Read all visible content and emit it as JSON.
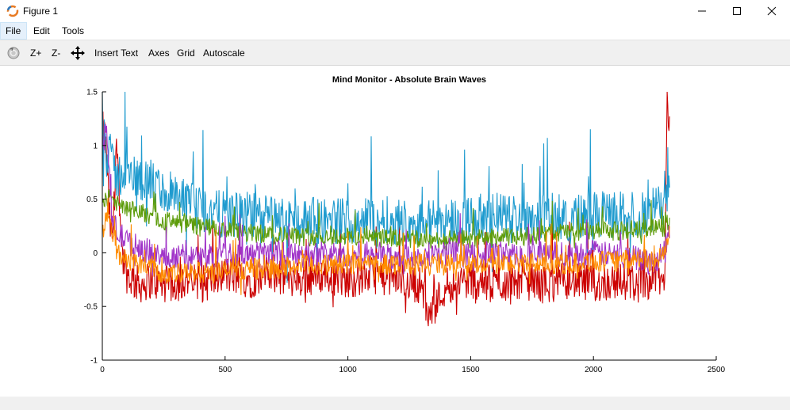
{
  "window": {
    "title": "Figure 1"
  },
  "menu": {
    "file": "File",
    "edit": "Edit",
    "tools": "Tools"
  },
  "toolbar": {
    "zoom_in": "Z+",
    "zoom_out": "Z-",
    "insert_text": "Insert Text",
    "axes": "Axes",
    "grid": "Grid",
    "autoscale": "Autoscale"
  },
  "chart_data": {
    "type": "line",
    "title": "Mind Monitor - Absolute Brain Waves",
    "xlim": [
      0,
      2500
    ],
    "ylim": [
      -1,
      1.5
    ],
    "xticks": [
      0,
      500,
      1000,
      1500,
      2000,
      2500
    ],
    "yticks": [
      -1,
      -0.5,
      0,
      0.5,
      1,
      1.5
    ],
    "xtick_labels": [
      "0",
      "500",
      "1000",
      "1500",
      "2000",
      "2500"
    ],
    "ytick_labels": [
      "-1",
      "-0.5",
      "0",
      "0.5",
      "1",
      "1.5"
    ],
    "grid": false,
    "series": [
      {
        "color": "#cc0000",
        "x": [
          0,
          10,
          20,
          30,
          40,
          50,
          60,
          80,
          100,
          120,
          150,
          200,
          250,
          300,
          350,
          400,
          450,
          500,
          600,
          700,
          800,
          900,
          1000,
          1100,
          1200,
          1300,
          1330,
          1400,
          1500,
          1600,
          1700,
          1800,
          1900,
          2000,
          2100,
          2200,
          2250,
          2290,
          2300,
          2310
        ],
        "values": [
          1.15,
          1.1,
          0.8,
          0.3,
          0.1,
          0.6,
          1.05,
          0.0,
          -0.2,
          -0.25,
          -0.3,
          -0.25,
          -0.3,
          -0.28,
          -0.25,
          -0.3,
          -0.25,
          -0.2,
          -0.25,
          -0.2,
          -0.25,
          -0.2,
          -0.25,
          -0.2,
          -0.25,
          -0.3,
          -0.6,
          -0.3,
          -0.25,
          -0.3,
          -0.25,
          -0.3,
          -0.25,
          -0.3,
          -0.25,
          -0.3,
          -0.2,
          -0.3,
          1.4,
          1.3
        ]
      },
      {
        "color": "#1f9bcf",
        "x": [
          0,
          10,
          20,
          30,
          40,
          60,
          80,
          100,
          150,
          200,
          250,
          300,
          350,
          400,
          450,
          500,
          600,
          700,
          800,
          900,
          1000,
          1100,
          1200,
          1300,
          1400,
          1500,
          1600,
          1700,
          1800,
          1900,
          2000,
          2100,
          2200,
          2250,
          2290,
          2300,
          2310
        ],
        "values": [
          1.0,
          1.2,
          0.9,
          1.1,
          0.8,
          0.7,
          0.75,
          0.72,
          0.7,
          0.65,
          0.55,
          0.5,
          0.45,
          0.4,
          0.38,
          0.35,
          0.35,
          0.32,
          0.3,
          0.3,
          0.3,
          0.32,
          0.3,
          0.28,
          0.3,
          0.32,
          0.35,
          0.33,
          0.35,
          0.33,
          0.35,
          0.36,
          0.35,
          0.4,
          0.5,
          0.6,
          0.8
        ]
      },
      {
        "color": "#5d9c0a",
        "x": [
          0,
          20,
          40,
          60,
          80,
          100,
          150,
          200,
          250,
          300,
          400,
          500,
          600,
          700,
          800,
          900,
          1000,
          1100,
          1200,
          1300,
          1400,
          1500,
          1600,
          1700,
          1800,
          1900,
          2000,
          2100,
          2200,
          2250,
          2300,
          2310
        ],
        "values": [
          0.45,
          0.5,
          0.55,
          0.45,
          0.42,
          0.4,
          0.38,
          0.35,
          0.3,
          0.28,
          0.25,
          0.2,
          0.18,
          0.17,
          0.15,
          0.15,
          0.15,
          0.14,
          0.13,
          0.12,
          0.12,
          0.13,
          0.14,
          0.15,
          0.17,
          0.2,
          0.2,
          0.2,
          0.22,
          0.25,
          0.3,
          0.3
        ]
      },
      {
        "color": "#a033c8",
        "x": [
          0,
          20,
          40,
          60,
          80,
          100,
          150,
          200,
          250,
          300,
          400,
          500,
          600,
          700,
          800,
          900,
          1000,
          1100,
          1200,
          1300,
          1400,
          1500,
          1600,
          1700,
          1800,
          1900,
          2000,
          2100,
          2200,
          2250,
          2300,
          2310
        ],
        "values": [
          1.05,
          1.1,
          0.3,
          0.2,
          0.15,
          0.1,
          0.05,
          0.0,
          -0.05,
          -0.03,
          -0.05,
          0.0,
          -0.02,
          0.0,
          -0.03,
          0.0,
          -0.02,
          0.0,
          -0.05,
          -0.02,
          0.0,
          -0.02,
          0.0,
          -0.03,
          0.0,
          -0.02,
          0.0,
          -0.03,
          -0.05,
          -0.1,
          0.1,
          0.2
        ]
      },
      {
        "color": "#ff8c00",
        "x": [
          0,
          20,
          40,
          60,
          80,
          100,
          150,
          200,
          250,
          300,
          400,
          500,
          600,
          700,
          800,
          900,
          1000,
          1100,
          1200,
          1300,
          1400,
          1500,
          1600,
          1700,
          1800,
          1900,
          2000,
          2100,
          2200,
          2250,
          2300,
          2310
        ],
        "values": [
          0.2,
          0.35,
          0.2,
          0.0,
          -0.05,
          -0.05,
          -0.1,
          -0.12,
          -0.2,
          -0.2,
          -0.18,
          -0.17,
          -0.15,
          -0.15,
          -0.12,
          -0.12,
          -0.1,
          -0.1,
          -0.1,
          -0.1,
          -0.1,
          -0.1,
          -0.1,
          -0.1,
          -0.1,
          -0.1,
          -0.08,
          -0.08,
          -0.05,
          -0.1,
          0.05,
          0.15
        ]
      }
    ]
  }
}
